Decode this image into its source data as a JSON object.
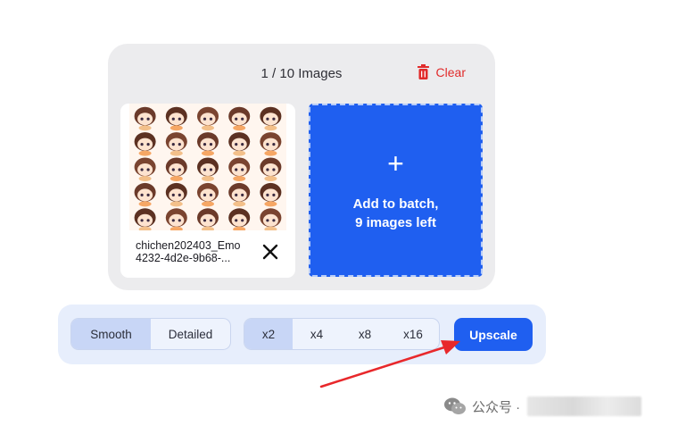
{
  "header": {
    "image_count": "1 / 10 Images",
    "clear_label": "Clear"
  },
  "file": {
    "name": "chichen202403_Emo\n4232-4d2e-9b68-..."
  },
  "dropzone": {
    "plus": "+",
    "text": "Add to batch,\n9 images left"
  },
  "modes": [
    {
      "label": "Smooth",
      "active": true
    },
    {
      "label": "Detailed",
      "active": false
    }
  ],
  "scales": [
    {
      "label": "x2",
      "active": true
    },
    {
      "label": "x4",
      "active": false
    },
    {
      "label": "x8",
      "active": false
    },
    {
      "label": "x16",
      "active": false
    }
  ],
  "upscale_label": "Upscale",
  "watermark": {
    "text": "公众号 ·"
  },
  "colors": {
    "accent": "#1f5ff0",
    "danger": "#e12b2b",
    "annotation_arrow": "#e8282b"
  }
}
